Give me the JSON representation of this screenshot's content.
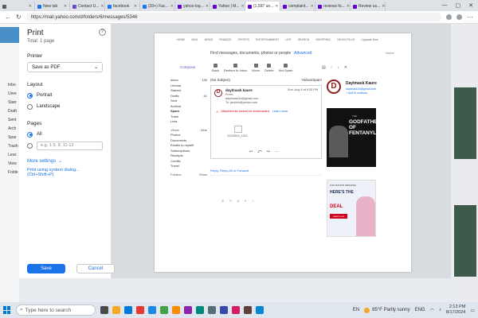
{
  "browser": {
    "tabs": [
      {
        "label": "",
        "color": "#5b5b5b"
      },
      {
        "label": "New tab",
        "color": "#1a73e8"
      },
      {
        "label": "Contact U...",
        "color": "#6b4bbf"
      },
      {
        "label": "facebook",
        "color": "#1877f2"
      },
      {
        "label": "(20+) Fac...",
        "color": "#1877f2"
      },
      {
        "label": "yahoo log...",
        "color": "#6001d2"
      },
      {
        "label": "Yahoo | M...",
        "color": "#6001d2"
      },
      {
        "label": "(1,597 un...",
        "color": "#6001d2",
        "active": true
      },
      {
        "label": "complaint...",
        "color": "#6001d2"
      },
      {
        "label": "reviews fo...",
        "color": "#6001d2"
      },
      {
        "label": "Review us...",
        "color": "#6001d2"
      }
    ],
    "url": "https://mail.yahoo.com/d/folders/6/messages/5346"
  },
  "print": {
    "title": "Print",
    "total": "Total: 1 page",
    "printer_label": "Printer",
    "printer_value": "Save as PDF",
    "layout_label": "Layout",
    "portrait": "Portrait",
    "landscape": "Landscape",
    "pages_label": "Pages",
    "pages_all": "All",
    "pages_placeholder": "e.g. 1-5, 8, 11-13",
    "more_settings": "More settings",
    "system_dialog": "Print using system dialog... (Ctrl+Shift+P)",
    "save": "Save",
    "cancel": "Cancel",
    "help": "?"
  },
  "background": {
    "sidebar": [
      "Inbo",
      "Unre",
      "Starr",
      "Draft",
      "Sent",
      "Arch",
      "Spar",
      "Trash",
      "Less",
      "View",
      "Folde"
    ]
  },
  "preview": {
    "nav": [
      "HOME",
      "MAIL",
      "NEWS",
      "FINANCE",
      "SPORTS",
      "ENTERTAINMENT",
      "LIFE",
      "SEARCH",
      "SHOPPING",
      "YAHOO PLUS",
      "Upgrade Now"
    ],
    "search_text": "Find messages, documents, photos or people",
    "advanced": "Advanced",
    "home": "Home",
    "compose": "Compose",
    "tools": [
      "Back",
      "Restore to Inbox",
      "Move",
      "Delete",
      "Not Spam"
    ],
    "folders": [
      {
        "name": "Inbox",
        "count": "130"
      },
      {
        "name": "Unread",
        "count": ""
      },
      {
        "name": "Starred",
        "count": ""
      },
      {
        "name": "Drafts",
        "count": "41"
      },
      {
        "name": "Sent",
        "count": ""
      },
      {
        "name": "Archive",
        "count": ""
      },
      {
        "name": "Spam",
        "count": ""
      },
      {
        "name": "Trash",
        "count": ""
      },
      {
        "name": "Less",
        "count": ""
      }
    ],
    "views_header": "Views",
    "views_hide": "Hide",
    "views": [
      "Photos",
      "Documents",
      "Emails to myself",
      "Subscriptions",
      "Receipts",
      "Credits",
      "Travel"
    ],
    "folders_header": "Folders",
    "folders_show": "Show",
    "subject": "(No Subject)",
    "folder_tag": "Yahoo/Spam",
    "sender": "daylmask kaure",
    "from": "From:",
    "sender_email": "daylmask34@gmail.com",
    "to": "To: jackwh@yahoo.com",
    "date": "Sun, Aug 4 at 9:33 PM",
    "warning": "Attachments cannot be downloaded.",
    "learn_more": "Learn more",
    "attachment": "20240815_1402...",
    "reply_links": "Reply, Reply All or Forward",
    "contact_name": "Daylmask Kaure",
    "contact_email": "daylmask34@gmail.com",
    "contact_add": "+ Add to contacts",
    "ad1_top": "THE",
    "ad1_title": "GODFATHER OF FENTANYL",
    "ad2_top": "FOX NATION ORIGINAL",
    "ad2_title": "HERE'S THE",
    "ad2_deal": "DEAL",
    "ad2_cta": "watch now"
  },
  "taskbar": {
    "search": "Type here to search",
    "weather": "85°F  Partly sunny",
    "lang": "ENG",
    "time": "2:13 PM",
    "date": "8/17/2024",
    "en_marker": "EN",
    "icon_colors": [
      "#4a4a4a",
      "#f9a825",
      "#0078d4",
      "#e53935",
      "#1e88e5",
      "#43a047",
      "#fb8c00",
      "#8e24aa",
      "#00897b",
      "#546e7a",
      "#3949ab",
      "#d81b60",
      "#5d4037",
      "#0288d1"
    ]
  }
}
